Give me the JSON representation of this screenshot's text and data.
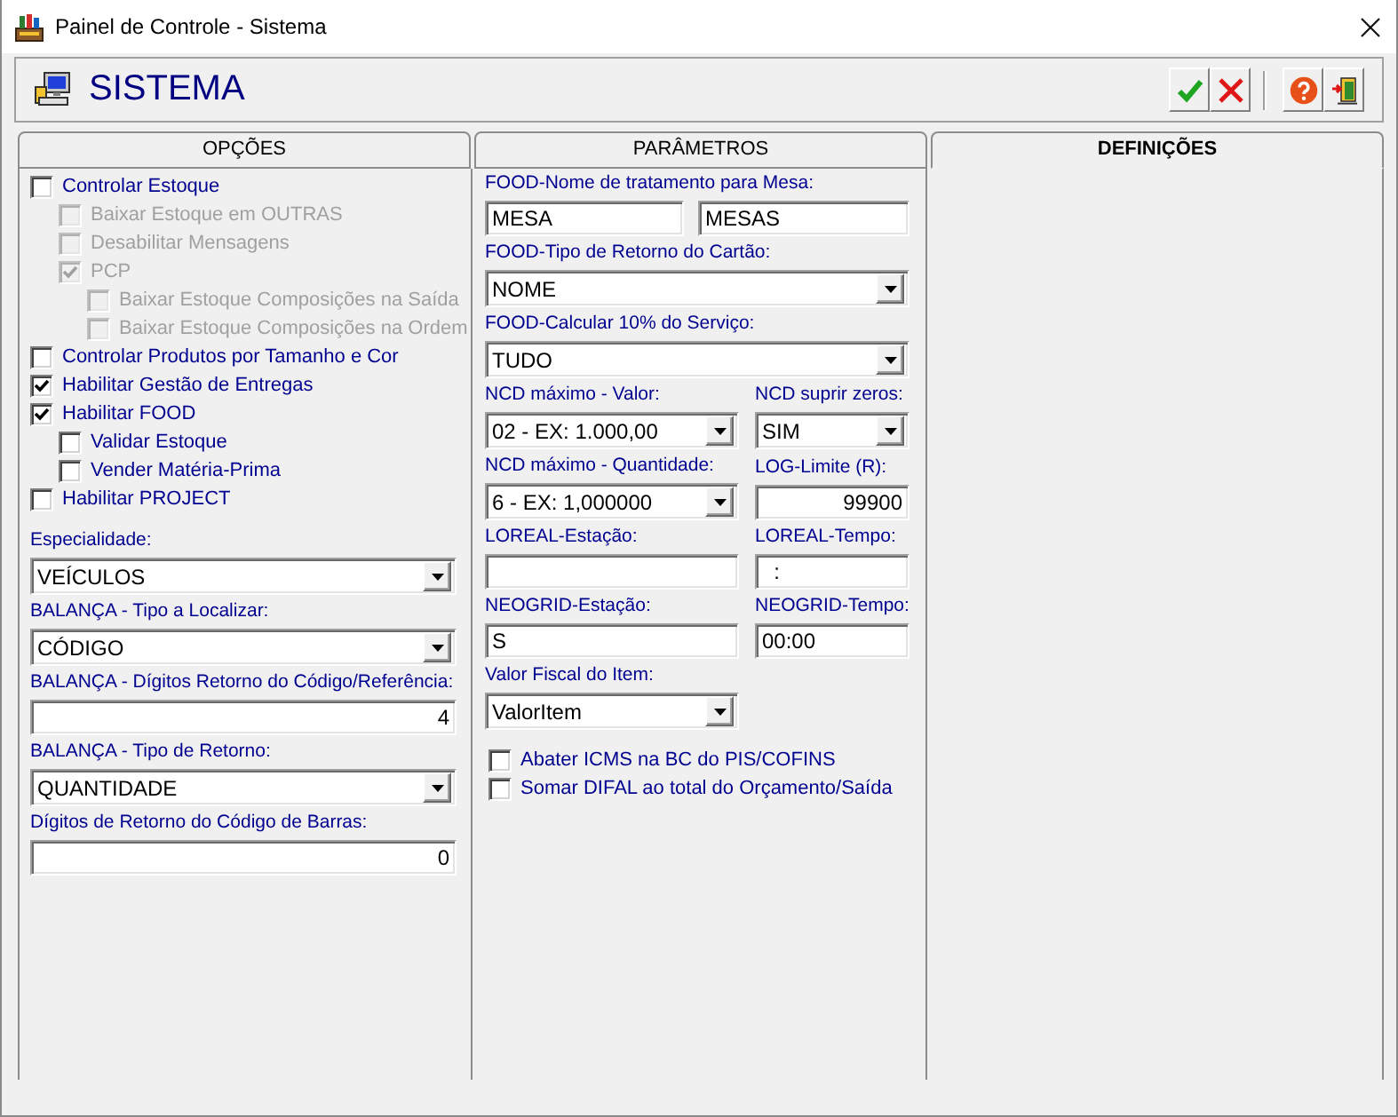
{
  "window": {
    "title": "Painel de Controle - Sistema"
  },
  "header": {
    "title": "SISTEMA"
  },
  "tabs": [
    {
      "label": "OPÇÕES",
      "selected": false
    },
    {
      "label": "PARÂMETROS",
      "selected": false
    },
    {
      "label": "DEFINIÇÕES",
      "selected": true
    }
  ],
  "options": [
    {
      "label": "Controlar Estoque",
      "checked": false,
      "disabled": false,
      "children": [
        {
          "label": "Baixar Estoque em OUTRAS",
          "checked": false,
          "disabled": true
        },
        {
          "label": "Desabilitar Mensagens",
          "checked": false,
          "disabled": true
        },
        {
          "label": "PCP",
          "checked": true,
          "disabled": true,
          "children": [
            {
              "label": "Baixar Estoque Composições na Saída",
              "checked": false,
              "disabled": true
            },
            {
              "label": "Baixar Estoque Composições na Ordem",
              "checked": false,
              "disabled": true
            }
          ]
        }
      ]
    },
    {
      "label": "Controlar Produtos por Tamanho e Cor",
      "checked": false,
      "disabled": false
    },
    {
      "label": "Habilitar Gestão de Entregas",
      "checked": true,
      "disabled": false
    },
    {
      "label": "Habilitar FOOD",
      "checked": true,
      "disabled": false,
      "children": [
        {
          "label": "Validar Estoque",
          "checked": false,
          "disabled": false
        },
        {
          "label": "Vender Matéria-Prima",
          "checked": false,
          "disabled": false
        }
      ]
    },
    {
      "label": "Habilitar PROJECT",
      "checked": false,
      "disabled": false
    }
  ],
  "option_fields": [
    {
      "kind": "combo",
      "label": "Especialidade:",
      "value": "VEÍCULOS"
    },
    {
      "kind": "combo",
      "label": "BALANÇA - Tipo a Localizar:",
      "value": "CÓDIGO"
    },
    {
      "kind": "number",
      "label": "BALANÇA - Dígitos Retorno do Código/Referência:",
      "value": "4"
    },
    {
      "kind": "combo",
      "label": "BALANÇA - Tipo de Retorno:",
      "value": "QUANTIDADE"
    },
    {
      "kind": "number",
      "label": "Dígitos de Retorno do Código de Barras:",
      "value": "0"
    }
  ],
  "parameters": [
    {
      "label": "FOOD-Nome de tratamento para Mesa:",
      "fields": [
        {
          "kind": "text",
          "value": "MESA"
        },
        {
          "kind": "text",
          "value": "MESAS"
        }
      ]
    },
    {
      "label": "FOOD-Tipo de Retorno do Cartão:",
      "fields": [
        {
          "kind": "combo",
          "value": "NOME"
        }
      ]
    },
    {
      "label": "FOOD-Calcular 10% do Serviço:",
      "fields": [
        {
          "kind": "combo",
          "value": "TUDO"
        }
      ]
    },
    {
      "fields": [
        {
          "kind": "combo",
          "label": "NCD máximo - Valor:",
          "value": "02 - EX: 1.000,00"
        },
        {
          "kind": "combo",
          "label": "NCD suprir zeros:",
          "value": "SIM"
        }
      ]
    },
    {
      "fields": [
        {
          "kind": "combo",
          "label": "NCD máximo - Quantidade:",
          "value": "6 - EX: 1,000000"
        },
        {
          "kind": "number",
          "label": "LOG-Limite (R):",
          "value": "99900"
        }
      ]
    },
    {
      "fields": [
        {
          "kind": "text",
          "label": "LOREAL-Estação:"
        },
        {
          "kind": "text",
          "label": "LOREAL-Tempo:",
          "value": "  :"
        }
      ]
    },
    {
      "fields": [
        {
          "kind": "text",
          "label": "NEOGRID-Estação:",
          "value": "S"
        },
        {
          "kind": "text",
          "label": "NEOGRID-Tempo:",
          "value": "00:00"
        }
      ]
    },
    {
      "fields": [
        {
          "kind": "combo",
          "label": "Valor Fiscal do Item:",
          "value": "ValorItem"
        }
      ]
    }
  ],
  "parameter_options": [
    {
      "label": "Abater ICMS na BC do PIS/COFINS",
      "checked": false
    },
    {
      "label": "Somar DIFAL ao total do Orçamento/Saída",
      "checked": false
    }
  ]
}
